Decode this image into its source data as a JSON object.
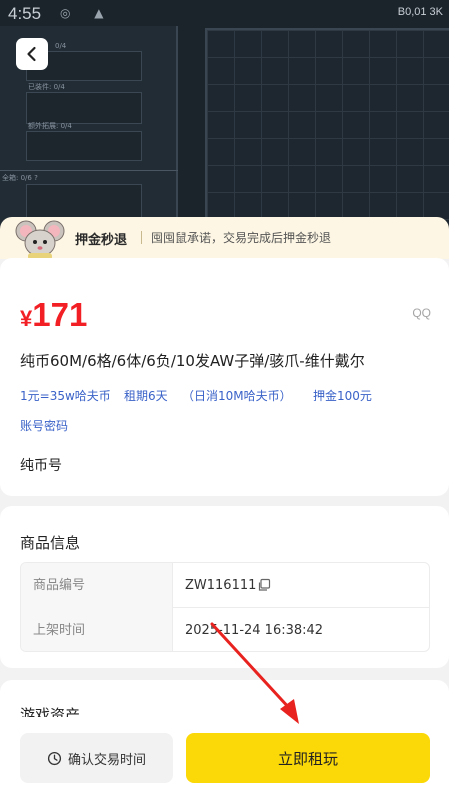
{
  "status_bar": {
    "time": "4:55",
    "right_text": "B0,01 3K"
  },
  "banner": {
    "title": "押金秒退",
    "text": "囤囤鼠承诺，交易完成后押金秒退"
  },
  "hero_labels": [
    "0/4",
    "已装件: 0/4",
    "额外拓展: 0/4",
    "全箱: 0/6 ?"
  ],
  "product": {
    "price_symbol": "¥",
    "price": "171",
    "platform": "QQ",
    "title": "纯币60M/6格/6体/6负/10发AW子弹/骇爪-维什戴尔",
    "specs": [
      "1元=35w哈夫币",
      "租期6天",
      "（日消10M哈夫币）",
      "押金100元"
    ],
    "login_type": "账号密码",
    "currency_type": "纯币号"
  },
  "product_info": {
    "title": "商品信息",
    "rows": [
      {
        "key": "商品编号",
        "value": "ZW116111"
      },
      {
        "key": "上架时间",
        "value": "2025-11-24 16:38:42"
      }
    ]
  },
  "game_assets": {
    "title": "游戏资产"
  },
  "actions": {
    "confirm_time": "确认交易时间",
    "rent_now": "立即租玩"
  },
  "colors": {
    "price_red": "#f21f25",
    "spec_blue": "#3a62c8",
    "primary_yellow": "#fbd808",
    "banner_bg": "#fdf6e4",
    "annotation_arrow": "#e8231f"
  }
}
